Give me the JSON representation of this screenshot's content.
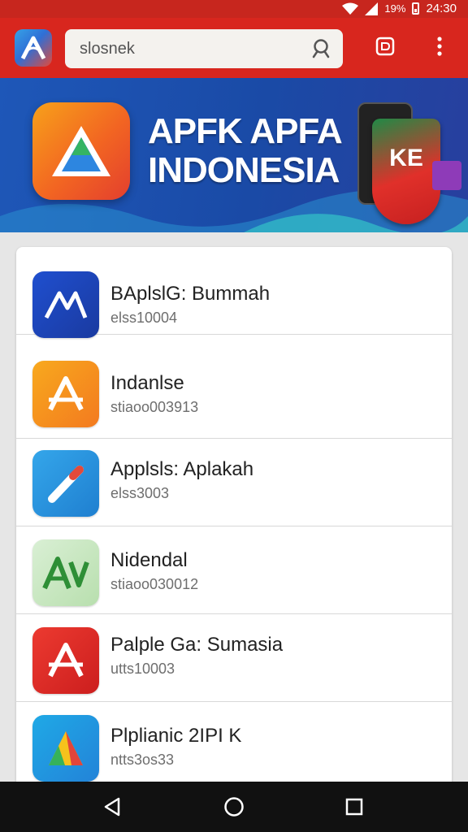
{
  "status_bar": {
    "battery": "19%",
    "time": "24:30",
    "icons": [
      "wifi-icon",
      "signal-icon",
      "battery-icon"
    ]
  },
  "toolbar": {
    "search_text": "slosnek",
    "icons": [
      "app-logo",
      "search-icon",
      "download-icon",
      "more-icon"
    ]
  },
  "banner": {
    "title_line1": "APFK APFA",
    "title_line2": "INDONESIA",
    "shield_text": "KE"
  },
  "apps": [
    {
      "title": "BAplslG: Bummah",
      "subtitle": "elss10004",
      "color": "#1f4fcf"
    },
    {
      "title": "Indanlse",
      "subtitle": "stiaoo003913",
      "color": "#f59a1b"
    },
    {
      "title": "Applsls: Aplakah",
      "subtitle": "elss3003",
      "color": "#2a90d9"
    },
    {
      "title": "Nidendal",
      "subtitle": "stiaoo030012",
      "color": "#3a9a3e"
    },
    {
      "title": "Palple Ga: Sumasia",
      "subtitle": "utts10003",
      "color": "#e0302a"
    },
    {
      "title": "Plplianic 2IPI K",
      "subtitle": "ntts3os33",
      "color": "#2ea7df"
    }
  ],
  "nav_bar": {
    "icons": [
      "back-icon",
      "home-icon",
      "recents-icon"
    ]
  }
}
